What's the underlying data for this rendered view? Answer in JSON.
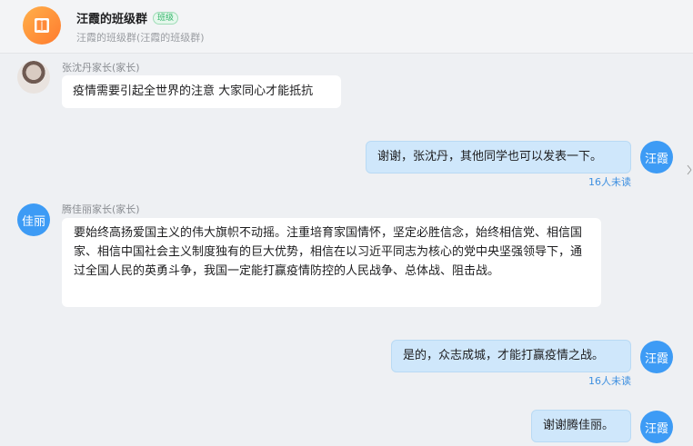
{
  "header": {
    "title": "汪霞的班级群",
    "badge": "班级",
    "subtitle": "汪霞的班级群(汪霞的班级群)"
  },
  "messages": [
    {
      "sender": "张沈丹家长(家长)",
      "text": "疫情需要引起全世界的注意 大家同心才能抵抗",
      "direction": "in"
    },
    {
      "avatar_text": "汪霞",
      "text": "谢谢，张沈丹，其他同学也可以发表一下。",
      "unread": "16人未读",
      "direction": "out"
    },
    {
      "avatar_text": "佳丽",
      "sender": "腾佳丽家长(家长)",
      "text": "要始终高扬爱国主义的伟大旗帜不动摇。注重培育家国情怀，坚定必胜信念，始终相信党、相信国家、相信中国社会主义制度独有的巨大优势，相信在以习近平同志为核心的党中央坚强领导下，通过全国人民的英勇斗争，我国一定能打赢疫情防控的人民战争、总体战、阻击战。",
      "direction": "in"
    },
    {
      "avatar_text": "汪霞",
      "text": "是的，众志成城，才能打赢疫情之战。",
      "unread": "16人未读",
      "direction": "out"
    },
    {
      "avatar_text": "汪霞",
      "text": "谢谢腾佳丽。",
      "direction": "out"
    }
  ],
  "colors": {
    "avatar_blue": "#3d9bf5",
    "outgoing_bubble": "#cfe7fb",
    "unread_text": "#3d8fe0",
    "badge_green": "#33b56a"
  }
}
